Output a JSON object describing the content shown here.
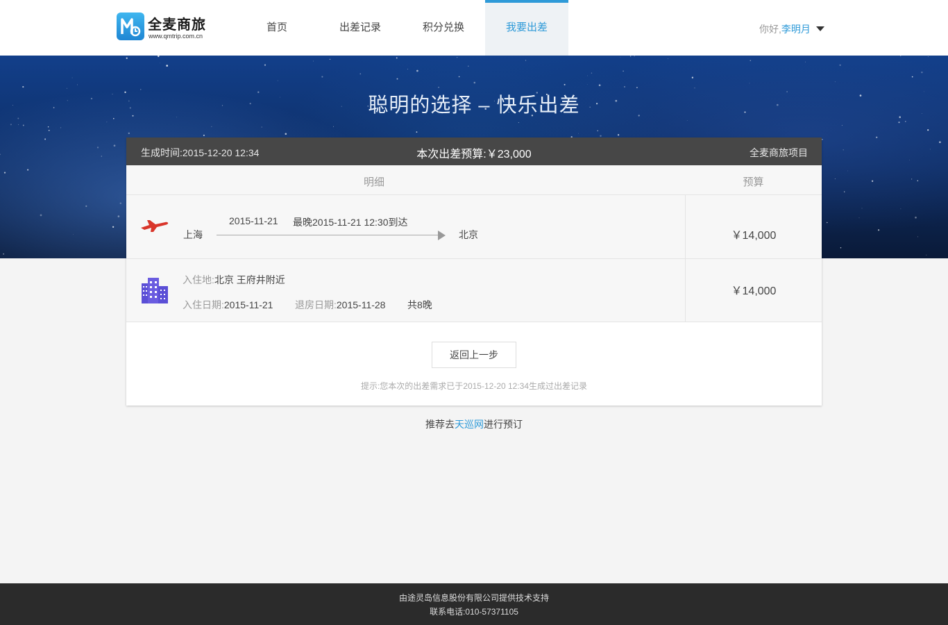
{
  "header": {
    "logo_name": "全麦商旅",
    "logo_url": "www.qmtrip.com.cn",
    "nav": [
      {
        "label": "首页"
      },
      {
        "label": "出差记录"
      },
      {
        "label": "积分兑换"
      },
      {
        "label": "我要出差",
        "active": true
      }
    ],
    "greeting": "你好,",
    "username": "李明月"
  },
  "banner": {
    "slogan": "聪明的选择 – 快乐出差"
  },
  "card": {
    "generated_time": "生成时间:2015-12-20 12:34",
    "budget_total": "本次出差预算:￥23,000",
    "project": "全麦商旅项目",
    "col_detail": "明细",
    "col_budget": "预算",
    "flight": {
      "from": "上海",
      "to": "北京",
      "date": "2015-11-21",
      "arrive_by": "最晚2015-11-21 12:30到达",
      "price": "￥14,000",
      "icon": "plane-icon"
    },
    "hotel": {
      "loc_label": "入住地:",
      "loc_value": "北京 王府井附近",
      "checkin_label": "入住日期:",
      "checkin_value": "2015-11-21",
      "checkout_label": "退房日期:",
      "checkout_value": "2015-11-28",
      "nights": "共8晚",
      "price": "￥14,000",
      "icon": "hotel-building-icon"
    },
    "back_button": "返回上一步",
    "tip": "提示:您本次的出差需求已于2015-12-20 12:34生成过出差记录"
  },
  "recommend": {
    "prefix": "推荐去",
    "link": "天巡网",
    "suffix": "进行预订"
  },
  "footer": {
    "line1": "由途灵岛信息股份有限公司提供技术支持",
    "line2": "联系电话:010-57371105"
  },
  "colors": {
    "accent": "#2e9ad8",
    "card_header": "#474747",
    "footer": "#2b2b2b",
    "plane": "#d9352a",
    "hotel": "#5b4fd6"
  }
}
